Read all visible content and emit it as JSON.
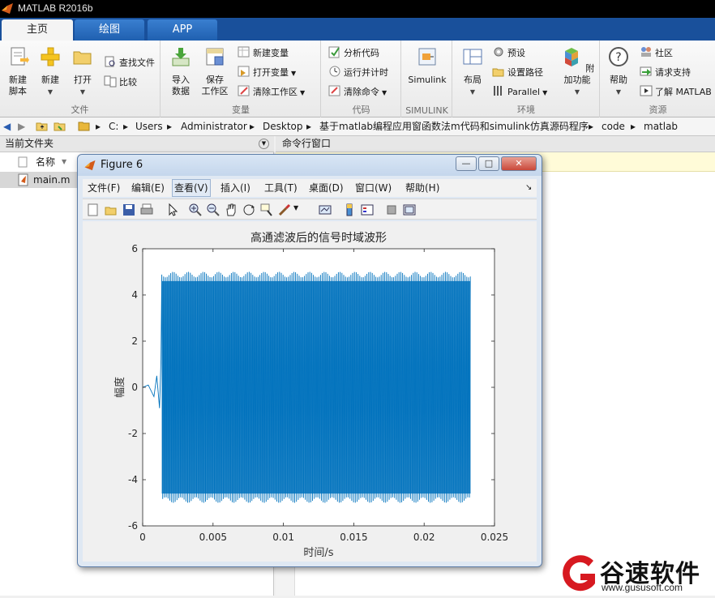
{
  "window": {
    "title": "MATLAB R2016b"
  },
  "ribbon": {
    "tabs": [
      {
        "label": "主页",
        "active": true
      },
      {
        "label": "绘图",
        "active": false
      },
      {
        "label": "APP",
        "active": false
      }
    ],
    "sections": {
      "file": {
        "label": "文件",
        "new_script": "新建\n脚本",
        "new": "新建",
        "open": "打开",
        "find_files": "查找文件",
        "compare": "比较"
      },
      "variable": {
        "label": "变量",
        "import": "导入\n数据",
        "save_ws": "保存\n工作区",
        "new_var": "新建变量",
        "open_var": "打开变量",
        "clear_ws": "清除工作区"
      },
      "code": {
        "label": "代码",
        "analyze": "分析代码",
        "run_time": "运行并计时",
        "clear_cmd": "清除命令"
      },
      "simulink": {
        "label": "SIMULINK",
        "btn": "Simulink"
      },
      "environment": {
        "label": "环境",
        "layout": "布局",
        "prefs": "预设",
        "set_path": "设置路径",
        "parallel": "Parallel",
        "addons": "附加功能"
      },
      "resources": {
        "label": "资源",
        "help": "帮助",
        "community": "社区",
        "request_support": "请求支持",
        "learn": "了解 MATLAB"
      }
    }
  },
  "address": {
    "crumbs": [
      "C:",
      "Users",
      "Administrator",
      "Desktop",
      "基于matlab编程应用窗函数法m代码和simulink仿真源码程序",
      "code",
      "matlab"
    ]
  },
  "current_folder": {
    "title": "当前文件夹",
    "col_name": "名称",
    "files": [
      "main.m"
    ]
  },
  "command_window": {
    "title": "命令行窗口"
  },
  "figure": {
    "title": "Figure 6",
    "menus": [
      "文件(F)",
      "编辑(E)",
      "查看(V)",
      "插入(I)",
      "工具(T)",
      "桌面(D)",
      "窗口(W)",
      "帮助(H)"
    ],
    "active_menu": "查看(V)"
  },
  "chart_data": {
    "type": "line",
    "title": "高通滤波后的信号时域波形",
    "xlabel": "时间/s",
    "ylabel": "幅度",
    "xlim": [
      0,
      0.025
    ],
    "ylim": [
      -6,
      6
    ],
    "xticks": [
      "0",
      "0.005",
      "0.01",
      "0.015",
      "0.02",
      "0.025"
    ],
    "yticks": [
      "6",
      "4",
      "2",
      "0",
      "-2",
      "-4",
      "-6"
    ],
    "line_color": "#0072BD",
    "grid": false,
    "signal": {
      "x_end": 0.0233,
      "onset_t": 0.001,
      "steady_amplitude": 5,
      "steady_min": -5,
      "envelope_ripple": 0.4,
      "pre_onset_peaks": [
        {
          "t": 0.0,
          "v": 0.0
        },
        {
          "t": 0.0004,
          "v": 0.1
        },
        {
          "t": 0.0008,
          "v": -0.4
        },
        {
          "t": 0.001,
          "v": 0.5
        },
        {
          "t": 0.0012,
          "v": -0.9
        },
        {
          "t": 0.0013,
          "v": 1.2
        }
      ]
    }
  },
  "watermark": {
    "brand": "谷速软件",
    "url": "www.gususoft.com"
  }
}
